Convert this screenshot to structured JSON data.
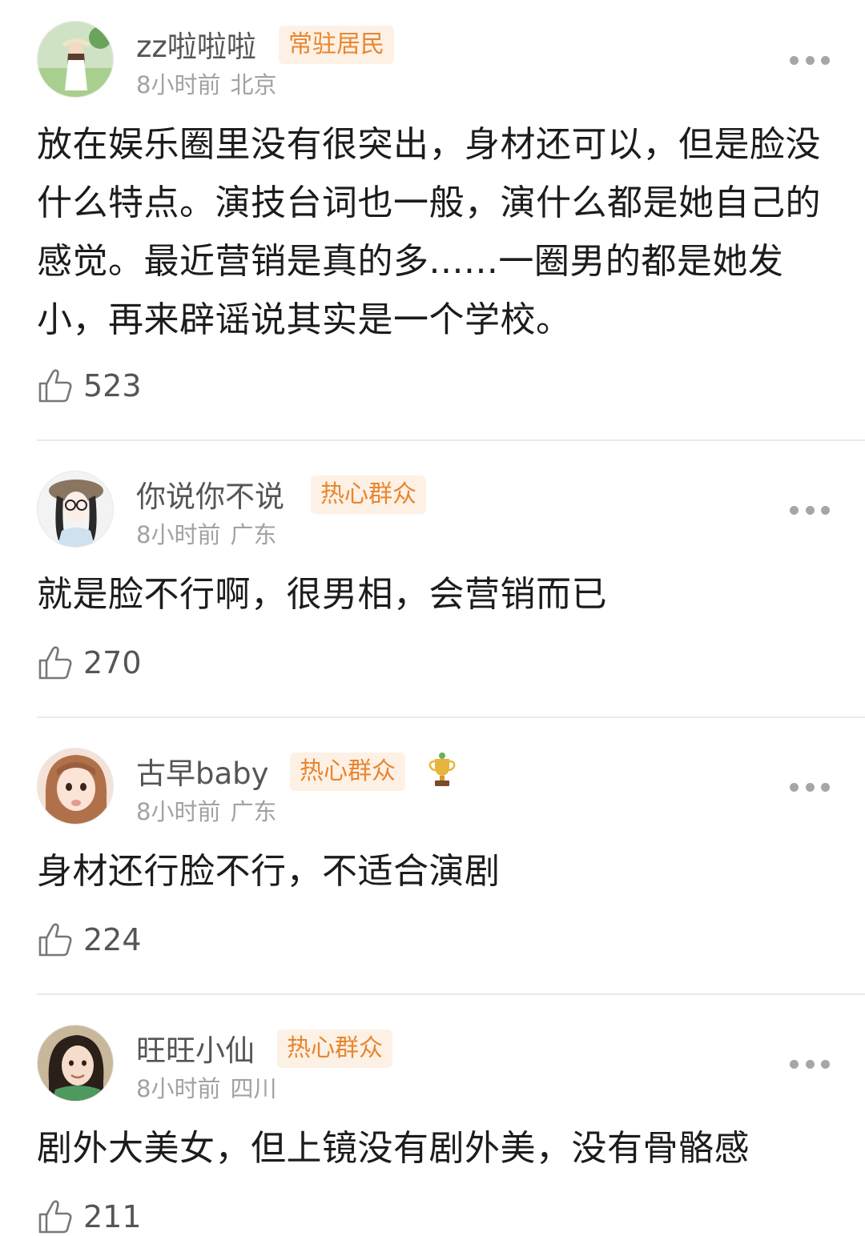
{
  "comments": [
    {
      "username": "zz啦啦啦",
      "badge": "常驻居民",
      "time": "8小时前",
      "location": "北京",
      "content": "放在娱乐圈里没有很突出，身材还可以，但是脸没什么特点。演技台词也一般，演什么都是她自己的感觉。最近营销是真的多......一圈男的都是她发小，再来辟谣说其实是一个学校。",
      "likes": "523"
    },
    {
      "username": "你说你不说",
      "badge": "热心群众",
      "time": "8小时前",
      "location": "广东",
      "content": "就是脸不行啊，很男相，会营销而已",
      "likes": "270"
    },
    {
      "username": "古早baby",
      "badge": "热心群众",
      "time": "8小时前",
      "location": "广东",
      "content": "身材还行脸不行，不适合演剧",
      "likes": "224"
    },
    {
      "username": "旺旺小仙",
      "badge": "热心群众",
      "time": "8小时前",
      "location": "四川",
      "content": "剧外大美女，但上镜没有剧外美，没有骨骼感",
      "likes": "211"
    }
  ],
  "icons": {
    "more": "more-dots-icon",
    "like": "thumbs-up-icon",
    "trophy": "trophy-icon"
  },
  "colors": {
    "badge_bg": "#fdf1e6",
    "badge_text": "#e8862f",
    "meta_text": "#a2a2a2"
  }
}
